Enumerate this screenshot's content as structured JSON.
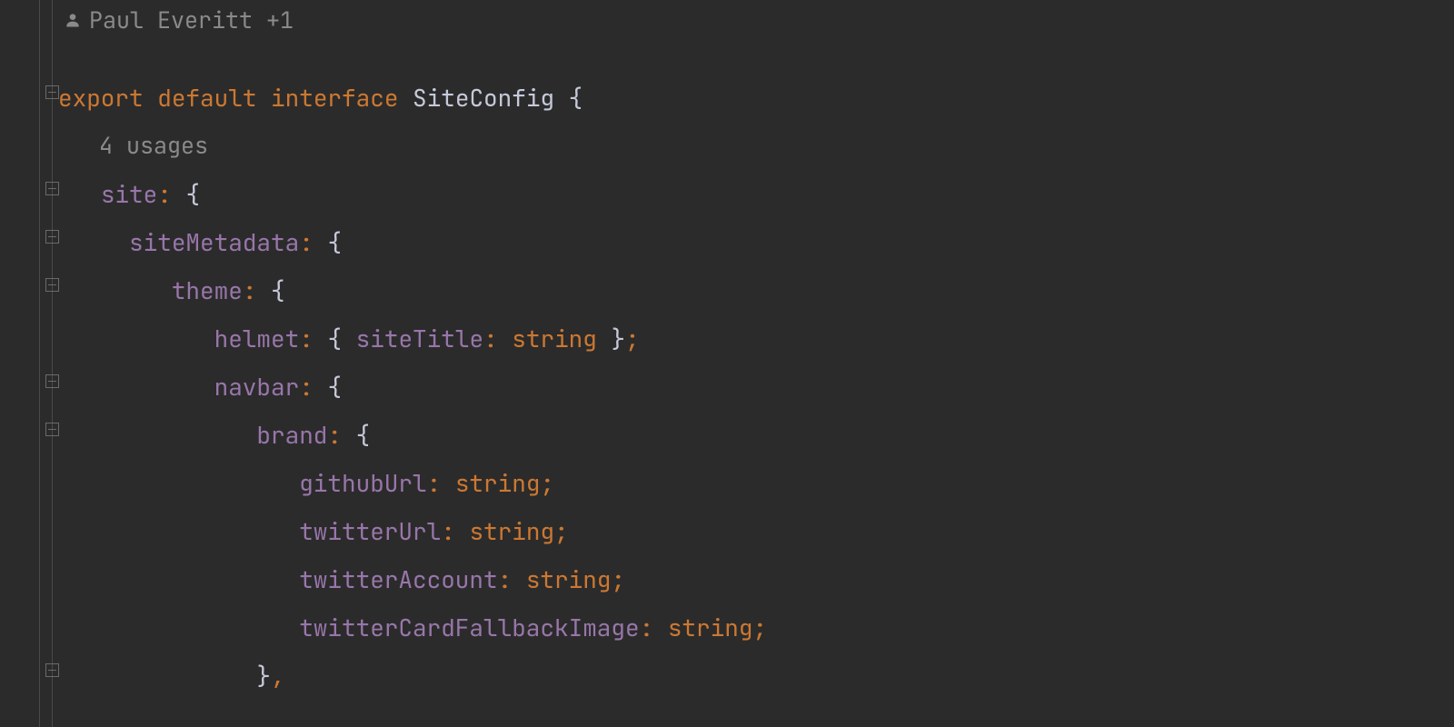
{
  "author_hint": "Paul Everitt +1",
  "usages_hint": "4 usages",
  "tokens": {
    "export": "export",
    "default": "default",
    "interface": "interface",
    "SiteConfig": "SiteConfig",
    "site": "site",
    "siteMetadata": "siteMetadata",
    "theme": "theme",
    "helmet": "helmet",
    "siteTitle": "siteTitle",
    "string": "string",
    "navbar": "navbar",
    "brand": "brand",
    "githubUrl": "githubUrl",
    "twitterUrl": "twitterUrl",
    "twitterAccount": "twitterAccount",
    "twitterCardFallbackImage": "twitterCardFallbackImage"
  },
  "colors": {
    "bg": "#2b2b2b",
    "keyword": "#cc7832",
    "property": "#9876aa",
    "identifier": "#c5c9d9",
    "hint": "#8a8a8a",
    "gutter_line": "#4a4a4a"
  }
}
